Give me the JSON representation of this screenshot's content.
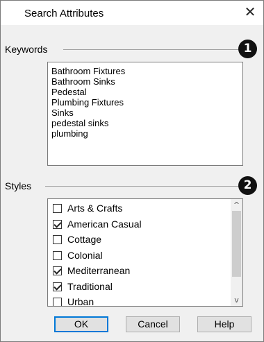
{
  "dialog": {
    "title": "Search Attributes",
    "close_glyph": "✕"
  },
  "keywords": {
    "label": "Keywords",
    "badge": "1",
    "items": [
      "Bathroom Fixtures",
      "Bathroom Sinks",
      "Pedestal",
      "Plumbing Fixtures",
      "Sinks",
      "pedestal sinks",
      "plumbing"
    ]
  },
  "styles": {
    "label": "Styles",
    "badge": "2",
    "items": [
      {
        "label": "Arts & Crafts",
        "checked": false
      },
      {
        "label": "American Casual",
        "checked": true
      },
      {
        "label": "Cottage",
        "checked": false
      },
      {
        "label": "Colonial",
        "checked": false
      },
      {
        "label": "Mediterranean",
        "checked": true
      },
      {
        "label": "Traditional",
        "checked": true
      },
      {
        "label": "Urban",
        "checked": false
      }
    ],
    "scroll_up": "^",
    "scroll_down": "v"
  },
  "buttons": {
    "ok": "OK",
    "cancel": "Cancel",
    "help": "Help"
  }
}
